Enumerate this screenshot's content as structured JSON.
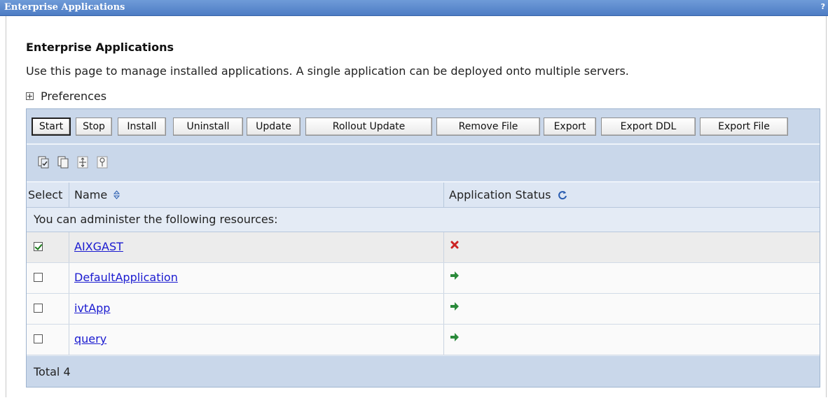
{
  "titlebar": {
    "title": "Enterprise Applications",
    "help_glyph": "?"
  },
  "page": {
    "heading": "Enterprise Applications",
    "description": "Use this page to manage installed applications. A single application can be deployed onto multiple servers.",
    "preferences_label": "Preferences"
  },
  "buttons": [
    {
      "label": "Start"
    },
    {
      "label": "Stop"
    },
    {
      "label": "Install"
    },
    {
      "label": "Uninstall"
    },
    {
      "label": "Update"
    },
    {
      "label": "Rollout Update"
    },
    {
      "label": "Remove File"
    },
    {
      "label": "Export"
    },
    {
      "label": "Export DDL"
    },
    {
      "label": "Export File"
    }
  ],
  "toolbar_icons": [
    "select-all-icon",
    "deselect-all-icon",
    "expand-icon",
    "filter-icon"
  ],
  "table": {
    "headers": {
      "select": "Select",
      "name": "Name",
      "status": "Application Status"
    },
    "admin_text": "You can administer the following resources:",
    "rows": [
      {
        "name": "AIXGAST",
        "checked": true,
        "status": "stopped"
      },
      {
        "name": "DefaultApplication",
        "checked": false,
        "status": "started"
      },
      {
        "name": "ivtApp",
        "checked": false,
        "status": "started"
      },
      {
        "name": "query",
        "checked": false,
        "status": "started"
      }
    ],
    "total": "Total 4"
  },
  "colors": {
    "titlebar": "#4d7cc4",
    "link": "#1a1ad0",
    "stopped": "#cc2222",
    "started": "#2a8a3a"
  }
}
